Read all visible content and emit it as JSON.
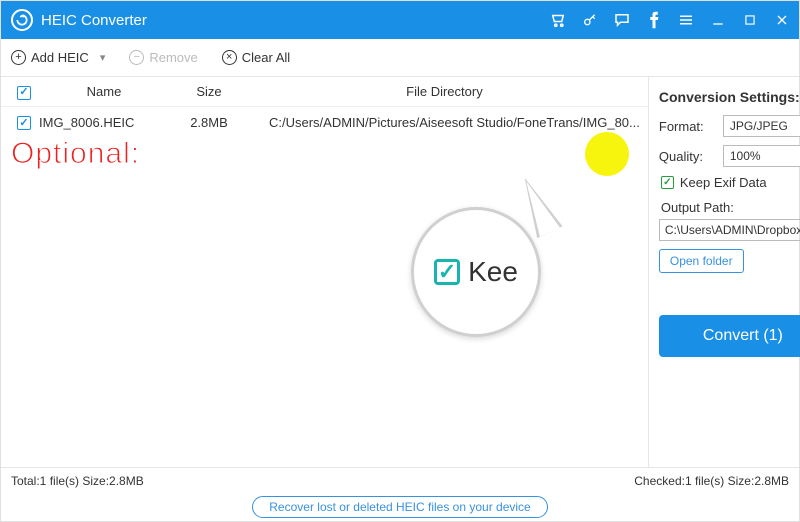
{
  "app": {
    "title": "HEIC Converter"
  },
  "toolbar": {
    "add_label": "Add HEIC",
    "remove_label": "Remove",
    "clear_label": "Clear All"
  },
  "table": {
    "headers": {
      "name": "Name",
      "size": "Size",
      "dir": "File Directory"
    },
    "rows": [
      {
        "checked": true,
        "name": "IMG_8006.HEIC",
        "size": "2.8MB",
        "dir": "C:/Users/ADMIN/Pictures/Aiseesoft Studio/FoneTrans/IMG_80..."
      }
    ]
  },
  "annotation": {
    "optional": "Optional:",
    "mag_text": "Kee"
  },
  "settings": {
    "title": "Conversion Settings:",
    "format_label": "Format:",
    "format_value": "JPG/JPEG",
    "quality_label": "Quality:",
    "quality_value": "100%",
    "keep_exif_label": "Keep Exif Data",
    "output_path_label": "Output Path:",
    "output_path_value": "C:\\Users\\ADMIN\\Dropbox\\PC\\",
    "open_folder_label": "Open folder",
    "convert_label": "Convert (1)"
  },
  "status": {
    "left": "Total:1 file(s) Size:2.8MB",
    "right": "Checked:1 file(s) Size:2.8MB"
  },
  "banner": {
    "text": "Recover lost or deleted HEIC files on your device"
  }
}
